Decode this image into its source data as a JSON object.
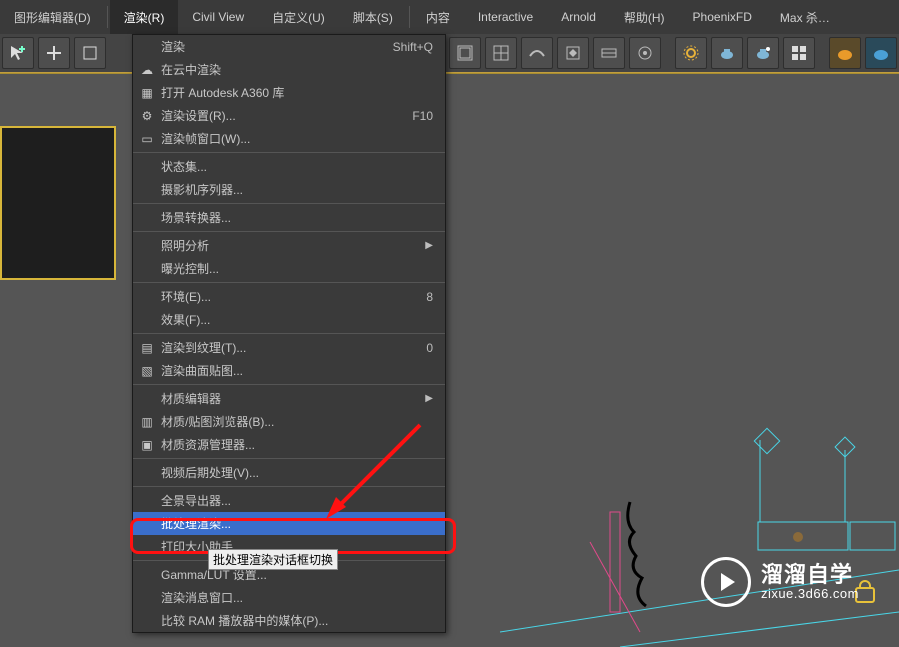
{
  "menubar": {
    "items": [
      {
        "label": "图形编辑器(D)"
      },
      {
        "label": "渲染(R)",
        "active": true
      },
      {
        "label": "Civil View"
      },
      {
        "label": "自定义(U)"
      },
      {
        "label": "脚本(S)"
      },
      {
        "label": "内容"
      },
      {
        "label": "Interactive"
      },
      {
        "label": "Arnold"
      },
      {
        "label": "帮助(H)"
      },
      {
        "label": "PhoenixFD"
      },
      {
        "label": "Max 杀…"
      }
    ]
  },
  "toolbar": {
    "icons": [
      "cursor-plus-icon",
      "axis-move-icon",
      "group-3",
      "panel-a-icon",
      "panel-b-icon",
      "panel-c-icon",
      "panel-d-icon",
      "panel-e-icon",
      "panel-f-icon",
      "panel-g-icon",
      "panel-h-icon",
      "gear-icon",
      "teapot-a-icon",
      "teapot-b-icon",
      "grid-icon",
      "sep",
      "render-orange-icon",
      "render-blue-icon"
    ]
  },
  "dropdown": {
    "items": [
      {
        "icon": "",
        "label": "渲染",
        "shortcut": "Shift+Q"
      },
      {
        "icon": "cloud-icon",
        "label": "在云中渲染"
      },
      {
        "icon": "a360-icon",
        "label": "打开 Autodesk A360 库"
      },
      {
        "icon": "settings-icon",
        "label": "渲染设置(R)...",
        "shortcut": "F10"
      },
      {
        "icon": "frame-icon",
        "label": "渲染帧窗口(W)..."
      },
      {
        "divider": true
      },
      {
        "label": "状态集..."
      },
      {
        "label": "摄影机序列器..."
      },
      {
        "divider": true
      },
      {
        "label": "场景转换器..."
      },
      {
        "divider": true
      },
      {
        "label": "照明分析",
        "submenu": true
      },
      {
        "label": "曝光控制..."
      },
      {
        "divider": true
      },
      {
        "label": "环境(E)...",
        "shortcut": "8"
      },
      {
        "label": "效果(F)..."
      },
      {
        "divider": true
      },
      {
        "icon": "tex-icon",
        "label": "渲染到纹理(T)...",
        "shortcut": "0"
      },
      {
        "icon": "surf-icon",
        "label": "渲染曲面贴图..."
      },
      {
        "divider": true
      },
      {
        "label": "材质编辑器",
        "submenu": true
      },
      {
        "icon": "browser-icon",
        "label": "材质/贴图浏览器(B)..."
      },
      {
        "icon": "asset-icon",
        "label": "材质资源管理器..."
      },
      {
        "divider": true
      },
      {
        "label": "视频后期处理(V)..."
      },
      {
        "divider": true
      },
      {
        "label": "全景导出器..."
      },
      {
        "label": "批处理渲染...",
        "highlight": true
      },
      {
        "label": "打印大小助手..."
      },
      {
        "divider": true
      },
      {
        "label": "Gamma/LUT 设置..."
      },
      {
        "label": "渲染消息窗口..."
      },
      {
        "label": "比较 RAM 播放器中的媒体(P)..."
      }
    ]
  },
  "tooltip": "批处理渲染对话框切换",
  "watermark": {
    "title": "溜溜自学",
    "url": "zixue.3d66.com"
  }
}
